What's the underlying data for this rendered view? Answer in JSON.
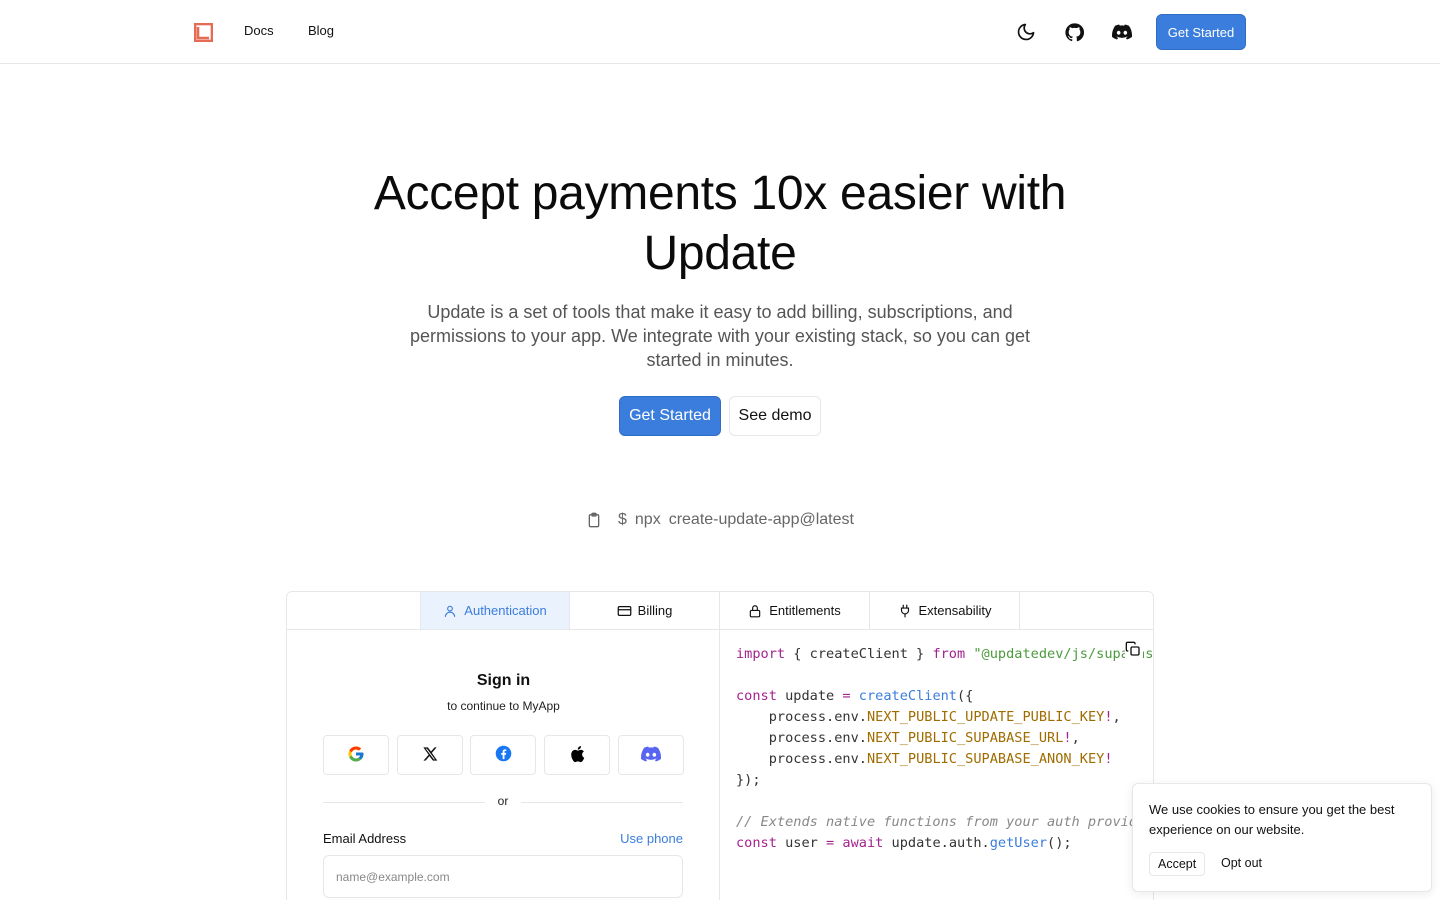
{
  "colors": {
    "accent": "#3b7ddd",
    "logo": "#e66b55"
  },
  "nav": {
    "links": [
      "Docs",
      "Blog"
    ],
    "icons": [
      "moon-icon",
      "github-icon",
      "discord-icon"
    ],
    "cta": "Get Started"
  },
  "hero": {
    "title": "Accept payments 10x easier with Update",
    "subtitle": "Update is a set of tools that make it easy to add billing, subscriptions, and permissions to your app. We integrate with your existing stack, so you can get started in minutes.",
    "primary_button": "Get Started",
    "secondary_button": "See demo"
  },
  "command": {
    "prompt": "$",
    "tool": "npx",
    "package": "create-update-app@latest"
  },
  "tabs": [
    {
      "label": "Authentication",
      "icon": "user-icon",
      "active": true
    },
    {
      "label": "Billing",
      "icon": "credit-card-icon",
      "active": false
    },
    {
      "label": "Entitlements",
      "icon": "lock-icon",
      "active": false
    },
    {
      "label": "Extensability",
      "icon": "plug-icon",
      "active": false
    }
  ],
  "signin": {
    "title": "Sign in",
    "subtitle": "to continue to MyApp",
    "providers": [
      "google-icon",
      "x-icon",
      "facebook-icon",
      "apple-icon",
      "discord-icon"
    ],
    "divider": "or",
    "email_label": "Email Address",
    "use_phone": "Use phone",
    "email_placeholder": "name@example.com"
  },
  "code": {
    "import_kw": "import",
    "import_names": "{ createClient }",
    "from_kw": "from",
    "import_path": "\"@updatedev/js/supabase\"",
    "const_kw": "const",
    "var_update": "update",
    "eq": "=",
    "create_fn": "createClient",
    "open": "({",
    "prefix": "process.env.",
    "env1": "NEXT_PUBLIC_UPDATE_PUBLIC_KEY",
    "env2": "NEXT_PUBLIC_SUPABASE_URL",
    "env3": "NEXT_PUBLIC_SUPABASE_ANON_KEY",
    "bang": "!",
    "comma": ",",
    "close": "});",
    "comment": "// Extends native functions from your auth provider",
    "var_user": "user",
    "await_kw": "await",
    "call_obj": "update.auth.",
    "call_fn": "getUser",
    "call_end": "();"
  },
  "cookie": {
    "text": "We use cookies to ensure you get the best experience on our website.",
    "accept": "Accept",
    "opt_out": "Opt out"
  }
}
